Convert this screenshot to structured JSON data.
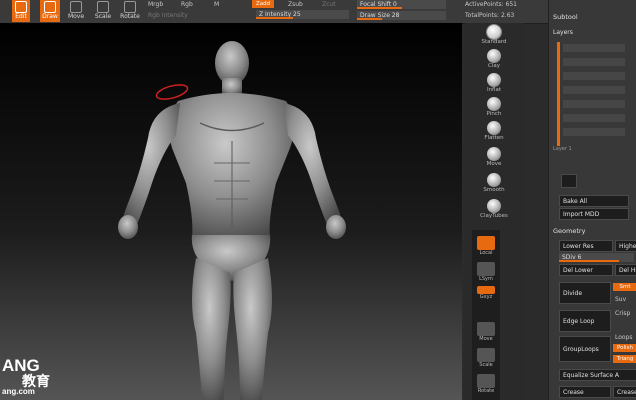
{
  "toolbar": {
    "edit_label": "Edit",
    "draw_label": "Draw",
    "move_label": "Move",
    "scale_label": "Scale",
    "rotate_label": "Rotate",
    "mrgb_label": "Mrgb",
    "rgb_label": "Rgb",
    "m_label": "M",
    "rgb_intensity_label": "Rgb Intensity",
    "zadd_label": "Zadd",
    "zsub_label": "Zsub",
    "zcut_label": "Zcut",
    "z_intensity": "Z Intensity 25",
    "focal_shift": "Focal Shift 0",
    "draw_size": "Draw Size 28",
    "active_points": "ActivePoints: 651",
    "total_points": "TotalPoints: 2.63"
  },
  "brushes": [
    "Standard",
    "Clay",
    "Inflat",
    "Pinch",
    "Flatten",
    "Move",
    "Smooth",
    "ClayTubes"
  ],
  "right_tools": [
    "Local",
    "LSym",
    "Gxyz",
    "Move",
    "Scale",
    "Rotate"
  ],
  "subtool_panel": {
    "subtool_title": "Subtool",
    "layers_title": "Layers",
    "layer_label": "Layer 1",
    "bake_all": "Bake All",
    "import_mdd": "Import MDD",
    "geometry_title": "Geometry",
    "lower_res": "Lower Res",
    "higher_res": "Highe",
    "sdiv": "SDiv 6",
    "del_lower": "Del Lower",
    "del_higher": "Del Hi",
    "divide": "Divide",
    "smt": "Smt",
    "suv": "Suv",
    "edge_loop": "Edge Loop",
    "crisp": "Crisp",
    "group_loops": "GroupLoops",
    "loops": "Loops",
    "polish": "Polish",
    "triangle": "Triang",
    "equalize": "Equalize Surface A",
    "crease": "Crease",
    "crease2": "Crease"
  },
  "watermark": {
    "line1": "ANG",
    "line2": "教育",
    "line3": "ang.com"
  },
  "colors": {
    "accent": "#e86a10",
    "background": "#2b2b2b"
  }
}
